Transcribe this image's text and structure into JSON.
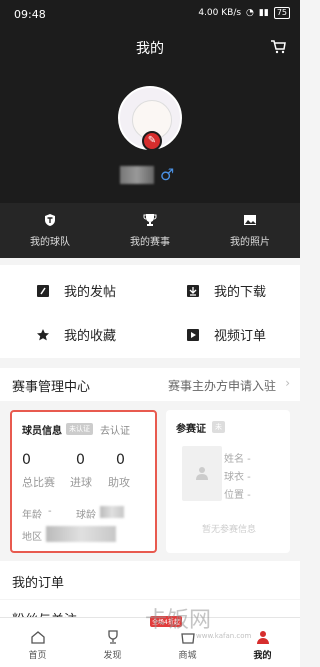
{
  "status": {
    "time": "09:48",
    "net": "4.00 KB/s",
    "battery": "75"
  },
  "header": {
    "title": "我的"
  },
  "quick": [
    {
      "label": "我的球队",
      "icon": "shield-t-icon"
    },
    {
      "label": "我的赛事",
      "icon": "trophy-icon"
    },
    {
      "label": "我的照片",
      "icon": "photo-icon"
    }
  ],
  "menu": [
    {
      "label": "我的发帖",
      "icon": "pencil-icon"
    },
    {
      "label": "我的下载",
      "icon": "download-icon"
    },
    {
      "label": "我的收藏",
      "icon": "star-icon"
    },
    {
      "label": "视频订单",
      "icon": "video-order-icon"
    }
  ],
  "management": {
    "label": "赛事管理中心",
    "link": "赛事主办方申请入驻"
  },
  "player": {
    "title": "球员信息",
    "tag": "未认证",
    "auth_label": "去认证",
    "stats": [
      {
        "value": "0",
        "label": "总比赛"
      },
      {
        "value": "0",
        "label": "进球"
      },
      {
        "value": "0",
        "label": "助攻"
      }
    ],
    "age_label": "年龄",
    "age_value": "-",
    "age_label2": "球龄",
    "region_label": "地区"
  },
  "cert": {
    "title": "参赛证",
    "tag": "未",
    "fields": [
      "姓名 -",
      "球衣 -",
      "位置 -"
    ],
    "button": "暂无参赛信息"
  },
  "rows": {
    "orders": "我的订单",
    "fans": "粉丝与关注"
  },
  "nav": [
    {
      "label": "首页",
      "icon": "home-icon"
    },
    {
      "label": "发现",
      "icon": "trophy-nav-icon"
    },
    {
      "label": "商城",
      "icon": "shop-icon",
      "badge": "全场4折起"
    },
    {
      "label": "我的",
      "icon": "profile-icon"
    }
  ],
  "watermark": {
    "text": "卡饭网",
    "url": "www.kafan.com"
  }
}
